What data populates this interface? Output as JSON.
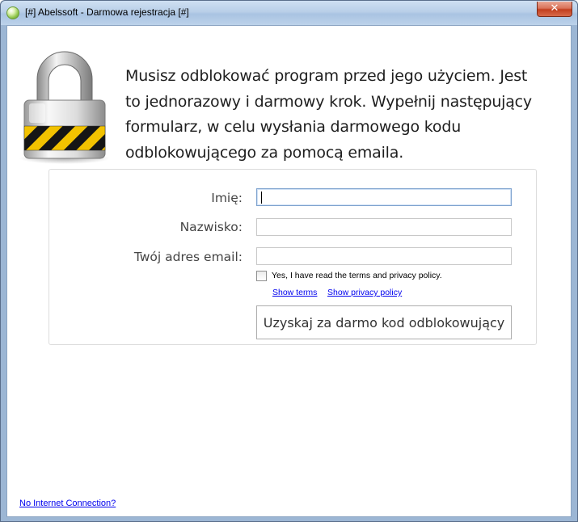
{
  "window": {
    "title": "[#] Abelssoft - Darmowa rejestracja [#]",
    "close_symbol": "✕"
  },
  "icons": {
    "app": "app-globe-icon",
    "lock": "padlock-icon"
  },
  "intro_text": "Musisz odblokować program przed jego użyciem. Jest to jednorazowy i darmowy krok. Wypełnij następujący formularz, w celu wysłania darmowego kodu odblokowującego za pomocą emaila.",
  "form": {
    "first_name_label": "Imię:",
    "first_name_value": "",
    "last_name_label": "Nazwisko:",
    "last_name_value": "",
    "email_label": "Twój adres email:",
    "email_value": "",
    "terms_checkbox_checked": false,
    "terms_label": "Yes, I have read the terms and privacy policy.",
    "show_terms": "Show terms",
    "show_privacy": "Show privacy policy",
    "submit_label": "Uzyskaj za darmo kod odblokowujący"
  },
  "footer": {
    "no_connection": "No Internet Connection?"
  },
  "colors": {
    "link": "#0000ee",
    "close_button": "#c23f1f",
    "stripe_yellow": "#f2c200",
    "stripe_black": "#151515"
  }
}
